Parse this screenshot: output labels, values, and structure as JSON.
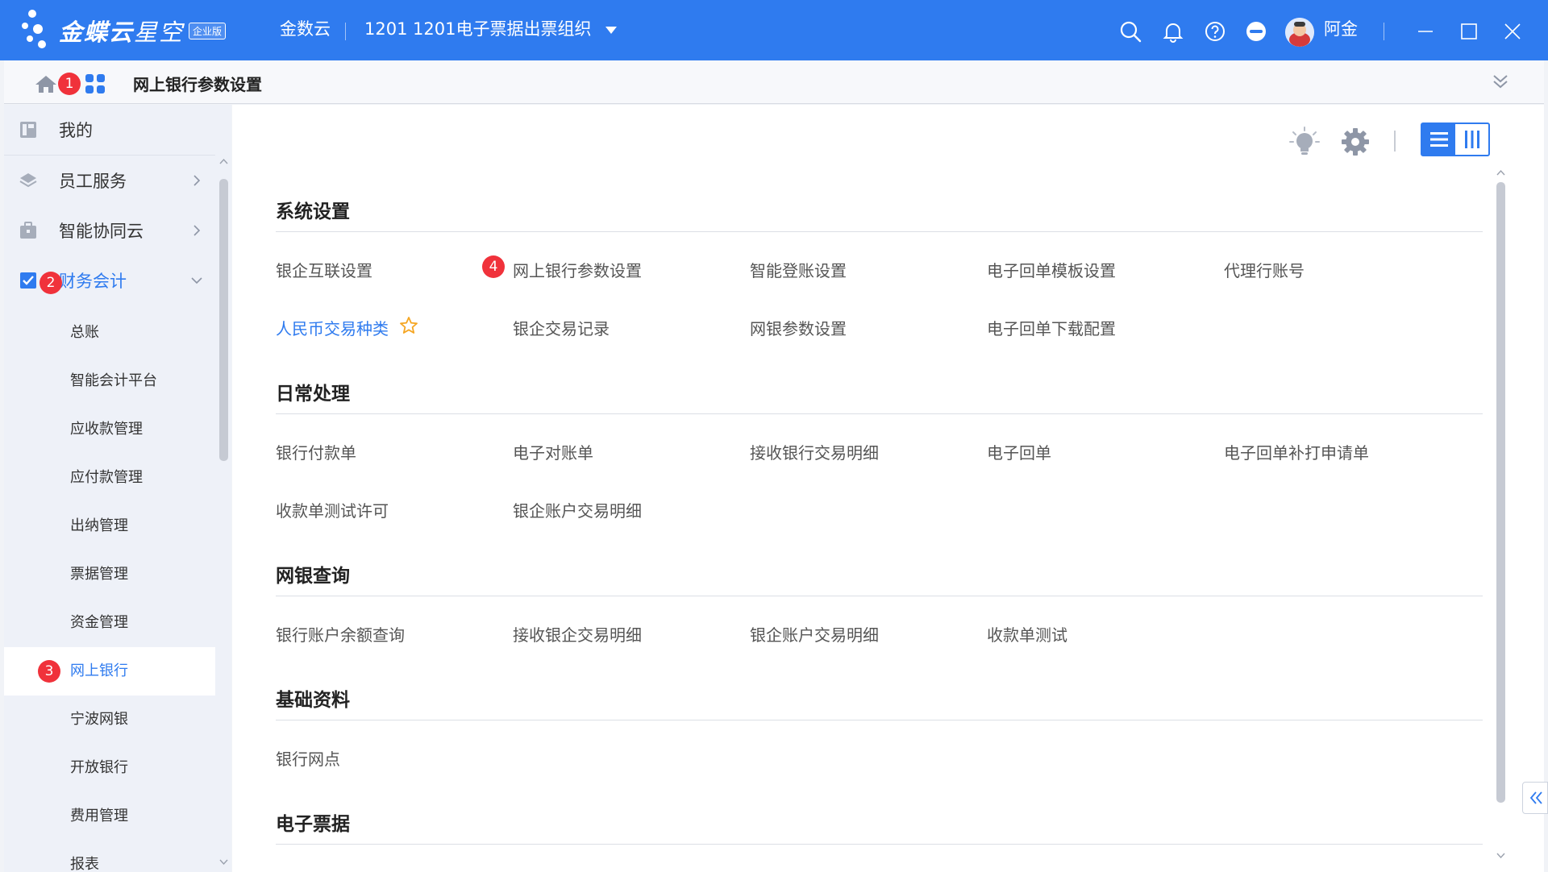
{
  "topbar": {
    "brand_main": "金蝶云",
    "brand_light": "星空",
    "brand_badge": "企业版",
    "product": "金数云",
    "org_code": "1201",
    "org_name": "1201电子票据出票组织",
    "user_name": "阿金"
  },
  "navbar": {
    "page_title": "网上银行参数设置"
  },
  "sidebar": {
    "items": [
      {
        "label": "我的"
      },
      {
        "label": "员工服务"
      },
      {
        "label": "智能协同云"
      },
      {
        "label": "财务会计"
      }
    ],
    "sub_items": [
      {
        "label": "总账"
      },
      {
        "label": "智能会计平台"
      },
      {
        "label": "应收款管理"
      },
      {
        "label": "应付款管理"
      },
      {
        "label": "出纳管理"
      },
      {
        "label": "票据管理"
      },
      {
        "label": "资金管理"
      },
      {
        "label": "网上银行"
      },
      {
        "label": "宁波网银"
      },
      {
        "label": "开放银行"
      },
      {
        "label": "费用管理"
      },
      {
        "label": "报表"
      }
    ]
  },
  "badges": [
    "1",
    "2",
    "3",
    "4"
  ],
  "sections": [
    {
      "title": "系统设置",
      "links": [
        "银企互联设置",
        "网上银行参数设置",
        "智能登账设置",
        "电子回单模板设置",
        "代理行账号",
        "人民币交易种类",
        "银企交易记录",
        "网银参数设置",
        "电子回单下载配置"
      ]
    },
    {
      "title": "日常处理",
      "links": [
        "银行付款单",
        "电子对账单",
        "接收银行交易明细",
        "电子回单",
        "电子回单补打申请单",
        "收款单测试许可",
        "银企账户交易明细"
      ]
    },
    {
      "title": "网银查询",
      "links": [
        "银行账户余额查询",
        "接收银企交易明细",
        "银企账户交易明细",
        "收款单测试"
      ]
    },
    {
      "title": "基础资料",
      "links": [
        "银行网点"
      ]
    },
    {
      "title": "电子票据",
      "links": []
    }
  ],
  "colors": {
    "primary": "#2f7bef",
    "badge": "#f0323b",
    "star": "#f5a623"
  }
}
